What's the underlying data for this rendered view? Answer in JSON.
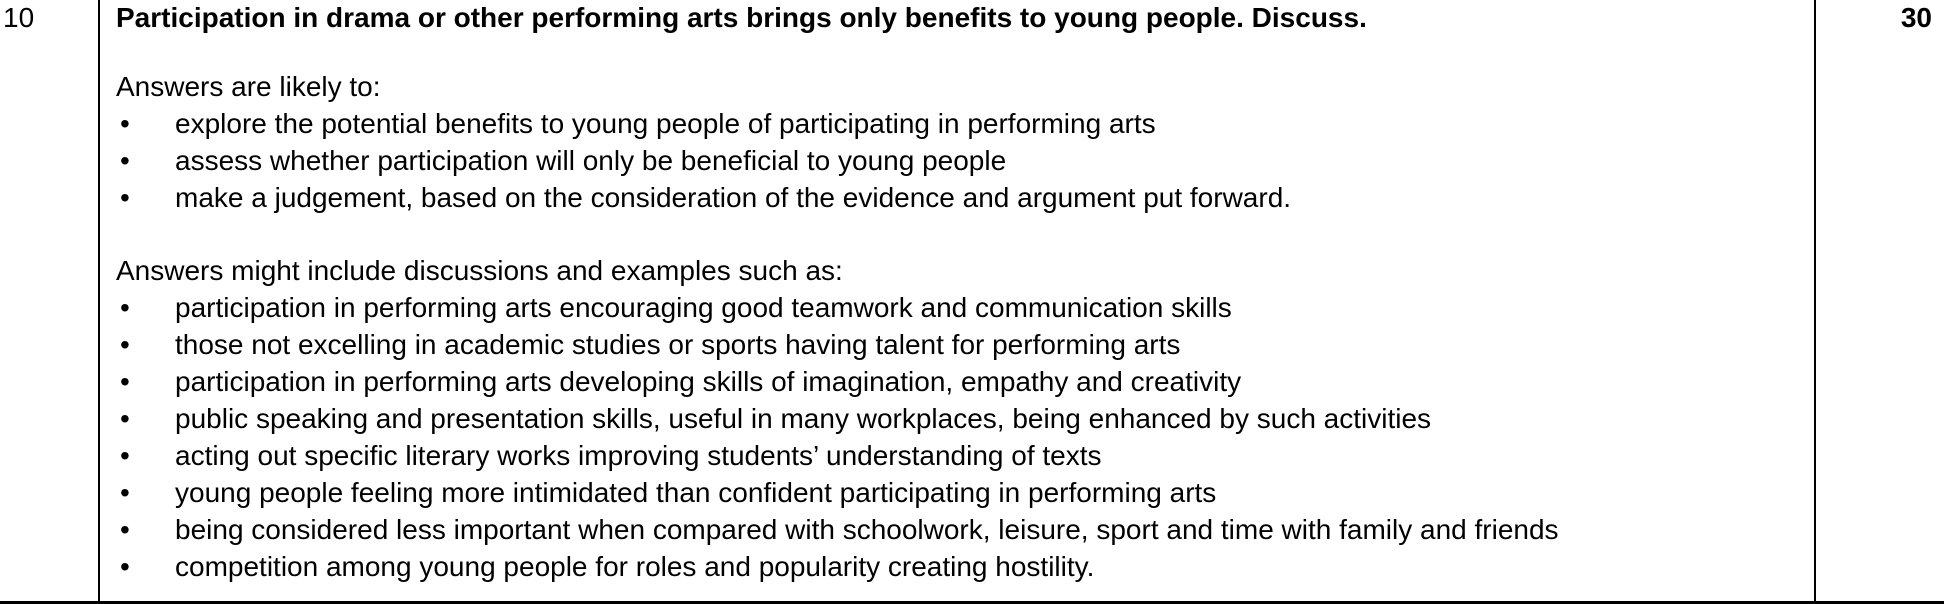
{
  "question": {
    "number": "10",
    "text": "Participation in drama or other performing arts brings only benefits to young people. Discuss.",
    "marks": "30"
  },
  "likely": {
    "intro": "Answers are likely to:",
    "items": [
      "explore the potential benefits to young people of participating in performing arts",
      "assess whether participation will only be beneficial to young people",
      "make a judgement, based on the consideration of the evidence and argument put forward."
    ]
  },
  "examples": {
    "intro": "Answers might include discussions and examples such as:",
    "items": [
      "participation in performing arts encouraging good teamwork and communication skills",
      "those not excelling in academic studies or sports having talent for performing arts",
      "participation in performing arts developing skills of imagination, empathy and creativity",
      "public speaking and presentation skills, useful in many workplaces, being enhanced by such activities",
      "acting out specific literary works improving students’ understanding of texts",
      "young people feeling more intimidated than confident participating in performing arts",
      "being considered less important when compared with schoolwork, leisure, sport and time with family and friends",
      "competition among young people for roles and popularity creating hostility."
    ]
  },
  "bullet_glyph": "•"
}
